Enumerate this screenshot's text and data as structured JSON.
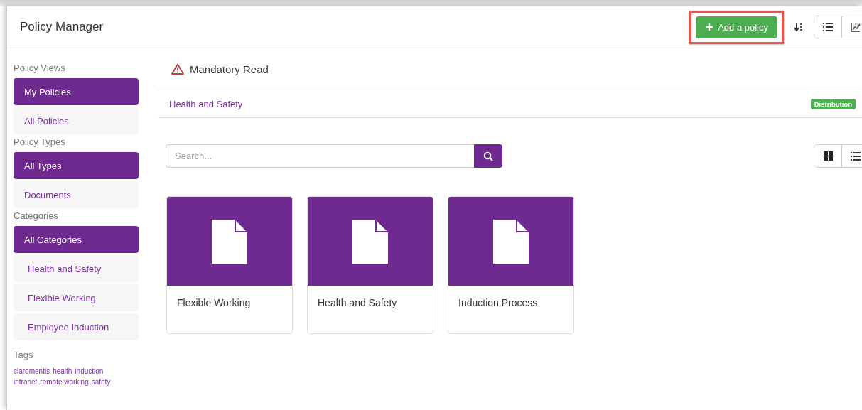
{
  "window": {
    "title": "Policy Manager"
  },
  "toolbar": {
    "add_button": {
      "label": "Add a policy",
      "highlighted": true
    }
  },
  "sidebar": {
    "sections": [
      {
        "heading": "Policy Views",
        "items": [
          {
            "label": "My Policies",
            "selected": true
          },
          {
            "label": "All Policies",
            "selected": false
          }
        ]
      },
      {
        "heading": "Policy Types",
        "items": [
          {
            "label": "All Types",
            "selected": true
          },
          {
            "label": "Documents",
            "selected": false
          }
        ]
      },
      {
        "heading": "Categories",
        "items": [
          {
            "label": "All Categories",
            "selected": true,
            "children": [
              {
                "label": "Health and Safety",
                "selected": false
              },
              {
                "label": "Flexible Working",
                "selected": false
              },
              {
                "label": "Employee Induction",
                "selected": false
              }
            ]
          }
        ]
      }
    ],
    "tags": {
      "heading": "Tags",
      "items": [
        "claromentis",
        "health",
        "induction",
        "intranet",
        "remote working",
        "safety"
      ]
    }
  },
  "mandatory": {
    "title": "Mandatory Read",
    "items": [
      {
        "title": "Health and Safety",
        "badge": "Distribution"
      }
    ]
  },
  "search": {
    "placeholder": "Search..."
  },
  "cards": [
    {
      "title": "Flexible Working"
    },
    {
      "title": "Health and Safety"
    },
    {
      "title": "Induction Process"
    }
  ]
}
